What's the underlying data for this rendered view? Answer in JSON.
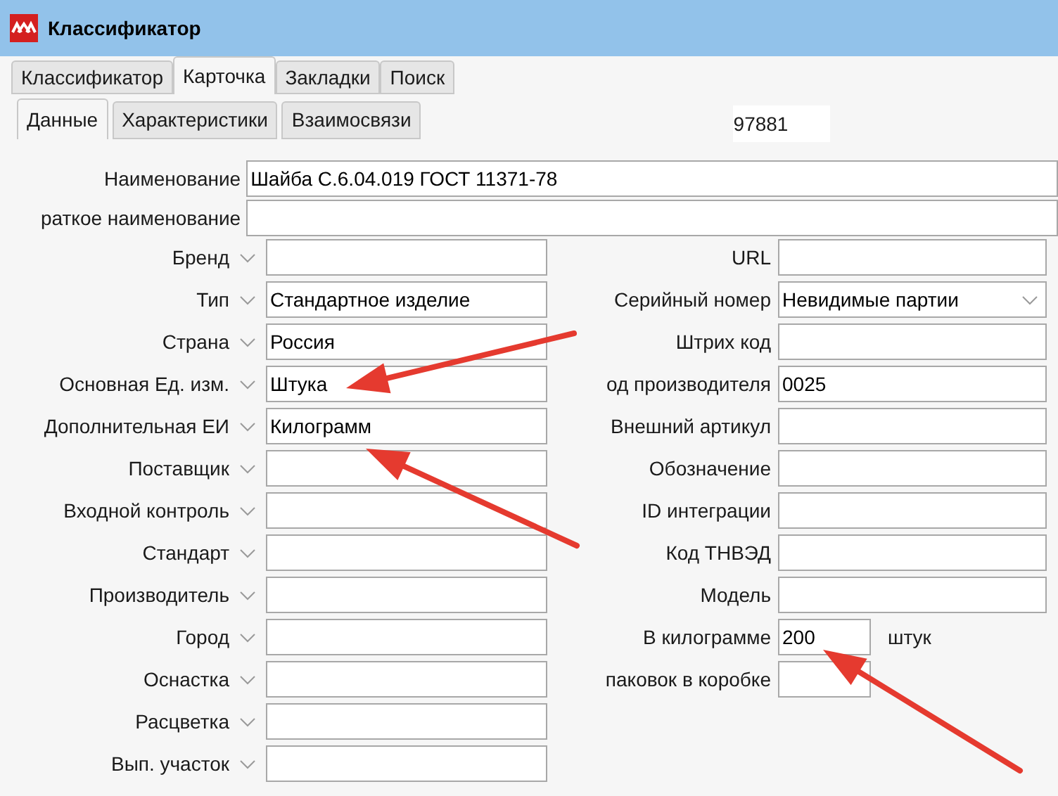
{
  "window": {
    "title": "Классификатор"
  },
  "tabs": [
    {
      "label": "Классификатор",
      "selected": false
    },
    {
      "label": "Карточка",
      "selected": true
    },
    {
      "label": "Закладки",
      "selected": false
    },
    {
      "label": "Поиск",
      "selected": false
    }
  ],
  "subtabs": [
    {
      "label": "Данные",
      "selected": true
    },
    {
      "label": "Характеристики",
      "selected": false
    },
    {
      "label": "Взаимосвязи",
      "selected": false
    }
  ],
  "record_id": "97881",
  "name_fields": [
    {
      "label": "Наименование",
      "value": "Шайба С.6.04.019 ГОСТ 11371-78"
    },
    {
      "label": "раткое наименование"
    }
  ],
  "left_fields": [
    {
      "label": "Бренд"
    },
    {
      "label": "Тип",
      "value": "Стандартное изделие"
    },
    {
      "label": "Страна",
      "value": "Россия"
    },
    {
      "label": "Основная Ед. изм.",
      "value": "Штука"
    },
    {
      "label": "Дополнительная ЕИ",
      "value": "Килограмм"
    },
    {
      "label": "Поставщик"
    },
    {
      "label": "Входной контроль"
    },
    {
      "label": "Стандарт"
    },
    {
      "label": "Производитель"
    },
    {
      "label": "Город"
    },
    {
      "label": "Оснастка"
    },
    {
      "label": "Расцветка"
    },
    {
      "label": "Вып. участок"
    }
  ],
  "right_fields": [
    {
      "kind": "text",
      "label": "URL"
    },
    {
      "kind": "dropdown",
      "label": "Серийный номер",
      "value": "Невидимые партии"
    },
    {
      "kind": "text",
      "label": "Штрих код"
    },
    {
      "kind": "text",
      "label": "од производителя",
      "value": "0025"
    },
    {
      "kind": "text",
      "label": "Внешний артикул"
    },
    {
      "kind": "text",
      "label": "Обозначение"
    },
    {
      "kind": "text",
      "label": "ID интеграции"
    },
    {
      "kind": "text",
      "label": "Код ТНВЭД"
    },
    {
      "kind": "text",
      "label": "Модель"
    },
    {
      "kind": "small",
      "label": "В килограмме",
      "value": "200",
      "unit": "штук"
    },
    {
      "kind": "small",
      "label": "паковок в коробке"
    }
  ]
}
